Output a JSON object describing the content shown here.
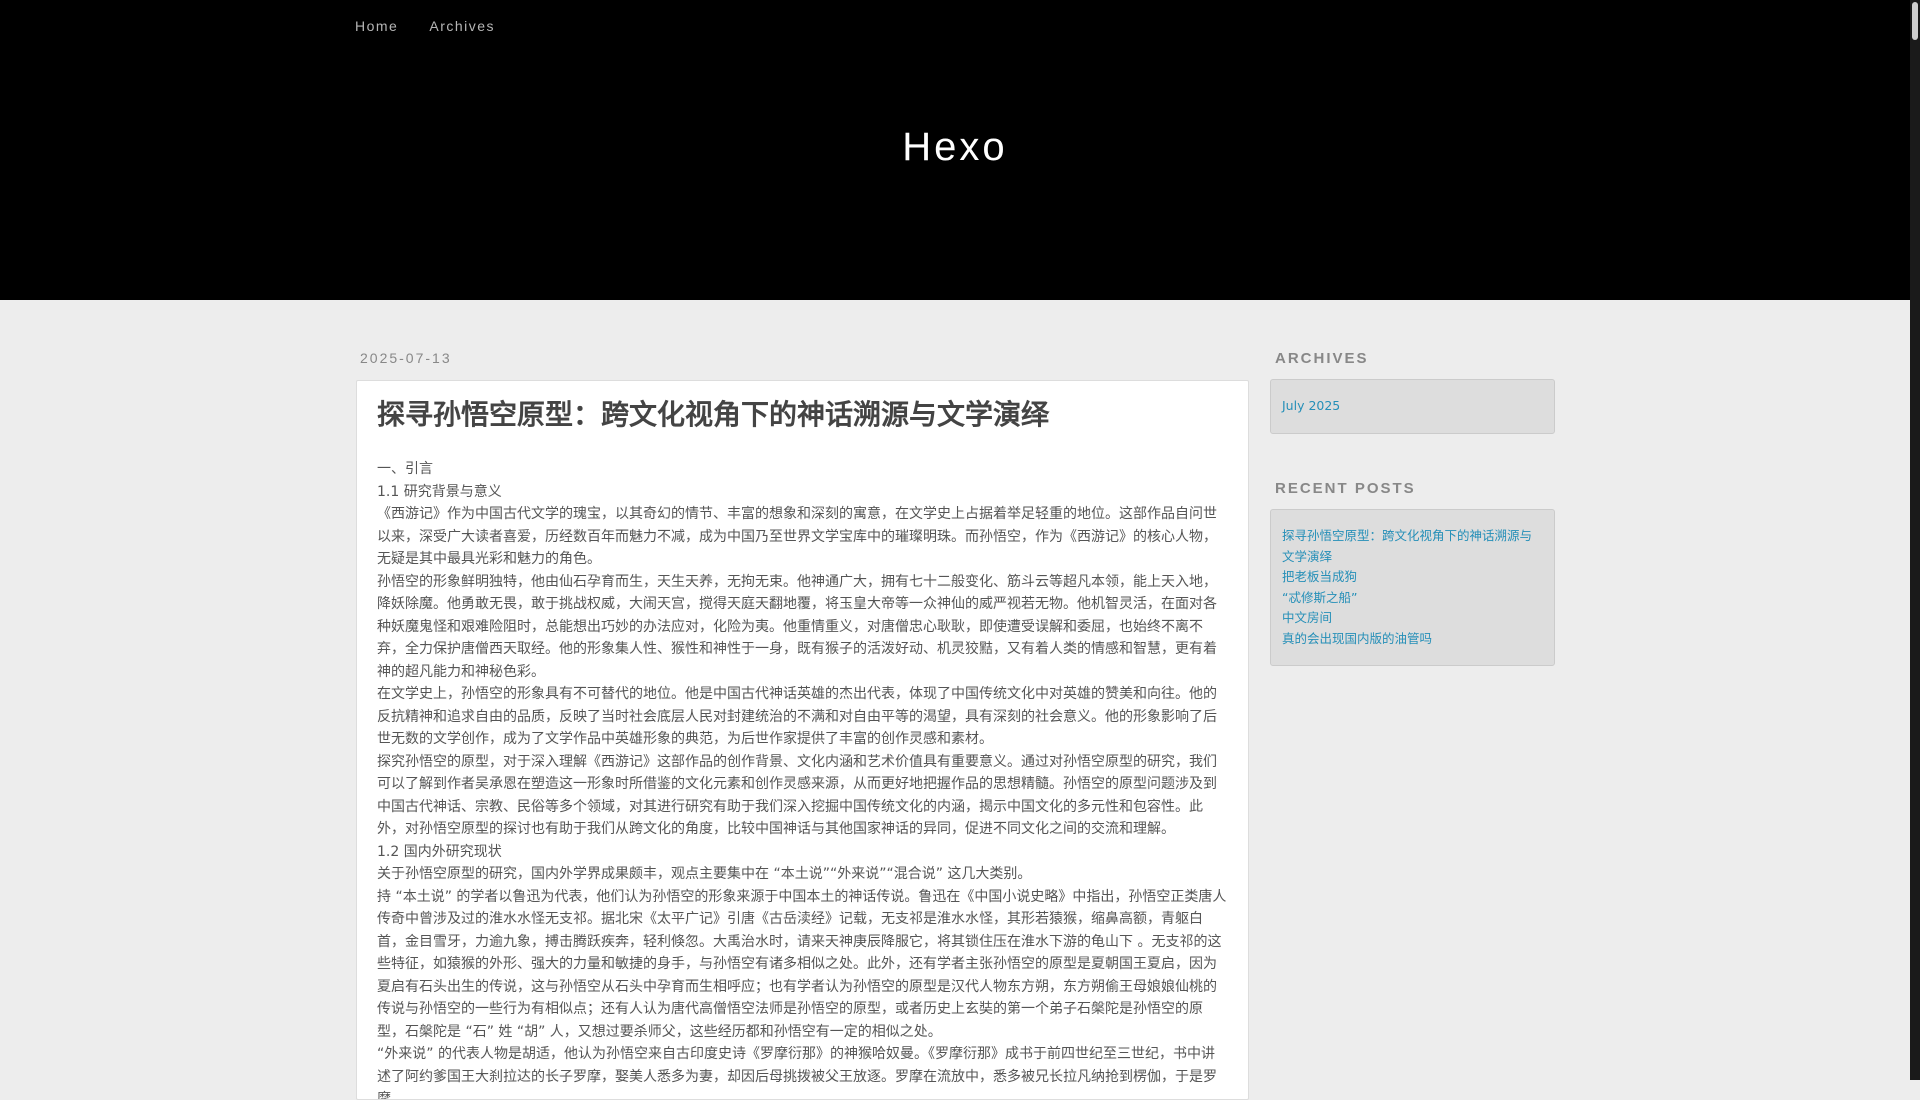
{
  "nav": {
    "home": "Home",
    "archives": "Archives"
  },
  "site": {
    "title": "Hexo"
  },
  "post": {
    "date": "2025-07-13",
    "title": "探寻孙悟空原型：跨文化视角下的神话溯源与文学演绎",
    "paragraphs": [
      "一、引言",
      "1.1 研究背景与意义",
      "《西游记》作为中国古代文学的瑰宝，以其奇幻的情节、丰富的想象和深刻的寓意，在文学史上占据着举足轻重的地位。这部作品自问世以来，深受广大读者喜爱，历经数百年而魅力不减，成为中国乃至世界文学宝库中的璀璨明珠。而孙悟空，作为《西游记》的核心人物，无疑是其中最具光彩和魅力的角色。",
      "孙悟空的形象鲜明独特，他由仙石孕育而生，天生天养，无拘无束。他神通广大，拥有七十二般变化、筋斗云等超凡本领，能上天入地，降妖除魔。他勇敢无畏，敢于挑战权威，大闹天宫，搅得天庭天翻地覆，将玉皇大帝等一众神仙的威严视若无物。他机智灵活，在面对各种妖魔鬼怪和艰难险阻时，总能想出巧妙的办法应对，化险为夷。他重情重义，对唐僧忠心耿耿，即使遭受误解和委屈，也始终不离不弃，全力保护唐僧西天取经。他的形象集人性、猴性和神性于一身，既有猴子的活泼好动、机灵狡黠，又有着人类的情感和智慧，更有着神的超凡能力和神秘色彩。",
      "在文学史上，孙悟空的形象具有不可替代的地位。他是中国古代神话英雄的杰出代表，体现了中国传统文化中对英雄的赞美和向往。他的反抗精神和追求自由的品质，反映了当时社会底层人民对封建统治的不满和对自由平等的渴望，具有深刻的社会意义。他的形象影响了后世无数的文学创作，成为了文学作品中英雄形象的典范，为后世作家提供了丰富的创作灵感和素材。",
      "探究孙悟空的原型，对于深入理解《西游记》这部作品的创作背景、文化内涵和艺术价值具有重要意义。通过对孙悟空原型的研究，我们可以了解到作者吴承恩在塑造这一形象时所借鉴的文化元素和创作灵感来源，从而更好地把握作品的思想精髓。孙悟空的原型问题涉及到中国古代神话、宗教、民俗等多个领域，对其进行研究有助于我们深入挖掘中国传统文化的内涵，揭示中国文化的多元性和包容性。此外，对孙悟空原型的探讨也有助于我们从跨文化的角度，比较中国神话与其他国家神话的异同，促进不同文化之间的交流和理解。",
      "1.2 国内外研究现状",
      "关于孙悟空原型的研究，国内外学界成果颇丰，观点主要集中在 “本土说”“外来说”“混合说” 这几大类别。",
      "持 “本土说” 的学者以鲁迅为代表，他们认为孙悟空的形象来源于中国本土的神话传说。鲁迅在《中国小说史略》中指出，孙悟空正类唐人传奇中曾涉及过的淮水水怪无支祁。据北宋《太平广记》引唐《古岳渎经》记载，无支祁是淮水水怪，其形若猿猴，缩鼻高额，青躯白首，金目雪牙，力逾九象，搏击腾跃疾奔，轻利倏忽。大禹治水时，请来天神庚辰降服它，将其锁住压在淮水下游的龟山下 。无支祁的这些特征，如猿猴的外形、强大的力量和敏捷的身手，与孙悟空有诸多相似之处。此外，还有学者主张孙悟空的原型是夏朝国王夏启，因为夏启有石头出生的传说，这与孙悟空从石头中孕育而生相呼应；也有学者认为孙悟空的原型是汉代人物东方朔，东方朔偷王母娘娘仙桃的传说与孙悟空的一些行为有相似点；还有人认为唐代高僧悟空法师是孙悟空的原型，或者历史上玄奘的第一个弟子石槃陀是孙悟空的原型，石槃陀是 “石” 姓 “胡” 人，又想过要杀师父，这些经历都和孙悟空有一定的相似之处。",
      "“外来说” 的代表人物是胡适，他认为孙悟空来自古印度史诗《罗摩衍那》的神猴哈奴曼。《罗摩衍那》成书于前四世纪至三世纪，书中讲述了阿约爹国王大刹拉达的长子罗摩，娶美人悉多为妻，却因后母挑拨被父王放逐。罗摩在流放中，悉多被兄长拉凡纳抢到楞伽，于是罗摩"
    ]
  },
  "sidebar": {
    "archives_heading": "ARCHIVES",
    "archives": [
      "July 2025"
    ],
    "recent_heading": "RECENT POSTS",
    "recent_posts": [
      "探寻孙悟空原型：跨文化视角下的神话溯源与文学演绎",
      "把老板当成狗",
      "“忒修斯之船”",
      "中文房间",
      "真的会出现国内版的油管吗"
    ]
  }
}
